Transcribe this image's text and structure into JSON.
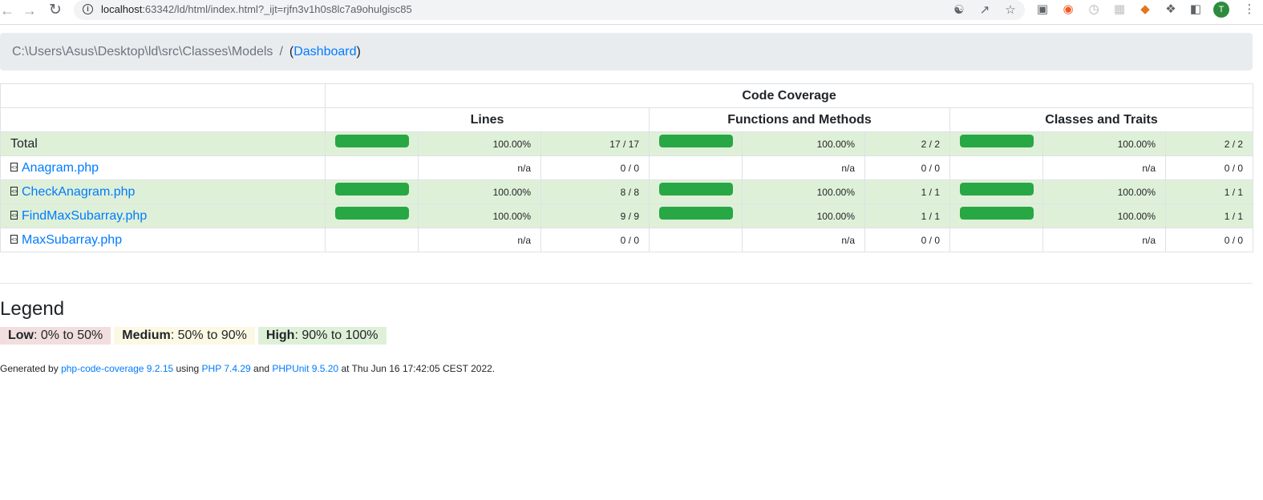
{
  "browser": {
    "url_host": "localhost",
    "url_rest": ":63342/ld/html/index.html?_ijt=rjfn3v1h0s8lc7a9ohulgisc85",
    "avatar_letter": "T"
  },
  "breadcrumb": {
    "path": "C:\\Users\\Asus\\Desktop\\ld\\src\\Classes\\Models",
    "separator": "/",
    "open_paren": "(",
    "link": "Dashboard",
    "close_paren": ")"
  },
  "table": {
    "group_header": "Code Coverage",
    "columns": [
      "Lines",
      "Functions and Methods",
      "Classes and Traits"
    ],
    "rows": [
      {
        "name": "Total",
        "is_link": false,
        "success": true,
        "lines": {
          "fill": 1.0,
          "pct": "100.00%",
          "count": "17 / 17"
        },
        "functions": {
          "fill": 1.0,
          "pct": "100.00%",
          "count": "2 / 2"
        },
        "classes": {
          "fill": 1.0,
          "pct": "100.00%",
          "count": "2 / 2"
        }
      },
      {
        "name": "Anagram.php",
        "is_link": true,
        "success": false,
        "lines": {
          "fill": null,
          "pct": "n/a",
          "count": "0 / 0"
        },
        "functions": {
          "fill": null,
          "pct": "n/a",
          "count": "0 / 0"
        },
        "classes": {
          "fill": null,
          "pct": "n/a",
          "count": "0 / 0"
        }
      },
      {
        "name": "CheckAnagram.php",
        "is_link": true,
        "success": true,
        "lines": {
          "fill": 1.0,
          "pct": "100.00%",
          "count": "8 / 8"
        },
        "functions": {
          "fill": 1.0,
          "pct": "100.00%",
          "count": "1 / 1"
        },
        "classes": {
          "fill": 1.0,
          "pct": "100.00%",
          "count": "1 / 1"
        }
      },
      {
        "name": "FindMaxSubarray.php",
        "is_link": true,
        "success": true,
        "lines": {
          "fill": 1.0,
          "pct": "100.00%",
          "count": "9 / 9"
        },
        "functions": {
          "fill": 1.0,
          "pct": "100.00%",
          "count": "1 / 1"
        },
        "classes": {
          "fill": 1.0,
          "pct": "100.00%",
          "count": "1 / 1"
        }
      },
      {
        "name": "MaxSubarray.php",
        "is_link": true,
        "success": false,
        "lines": {
          "fill": null,
          "pct": "n/a",
          "count": "0 / 0"
        },
        "functions": {
          "fill": null,
          "pct": "n/a",
          "count": "0 / 0"
        },
        "classes": {
          "fill": null,
          "pct": "n/a",
          "count": "0 / 0"
        }
      }
    ]
  },
  "legend": {
    "title": "Legend",
    "low_label": "Low",
    "low_range": ": 0% to 50%",
    "medium_label": "Medium",
    "medium_range": ": 50% to 90%",
    "high_label": "High",
    "high_range": ": 90% to 100%"
  },
  "footer": {
    "prefix": "Generated by ",
    "tool_link": "php-code-coverage 9.2.15",
    "using": " using ",
    "php_link": "PHP 7.4.29",
    "and": " and ",
    "phpunit_link": "PHPUnit 9.5.20",
    "suffix": " at Thu Jun 16 17:42:05 CEST 2022."
  },
  "colors": {
    "success_row": "#dff0d8",
    "bar": "#28a745",
    "link": "#007bff",
    "low": "#f2dede",
    "medium": "#fcf8e3",
    "high": "#dff0d8"
  }
}
